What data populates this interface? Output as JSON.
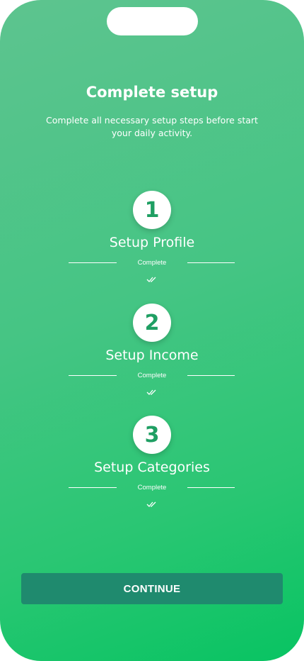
{
  "header": {
    "title": "Complete setup",
    "subtitle": "Complete all necessary setup steps before start your daily activity."
  },
  "steps": [
    {
      "number": "1",
      "label": "Setup Profile",
      "status": "Complete",
      "status_icon": "double-check-icon"
    },
    {
      "number": "2",
      "label": "Setup Income",
      "status": "Complete",
      "status_icon": "double-check-icon"
    },
    {
      "number": "3",
      "label": "Setup Categories",
      "status": "Complete",
      "status_icon": "double-check-icon"
    }
  ],
  "footer": {
    "continue_label": "CONTINUE"
  },
  "colors": {
    "gradient_top": "#5dc48f",
    "gradient_bottom": "#08c462",
    "number_color": "#1f9f63",
    "button_bg": "#1f8a6e",
    "text": "#ffffff"
  }
}
